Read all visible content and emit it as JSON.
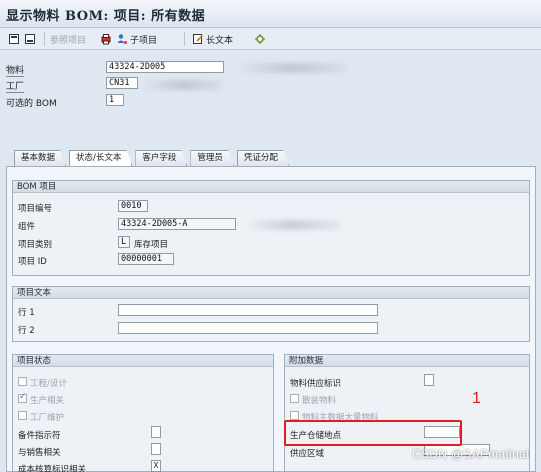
{
  "window": {
    "title": "显示物料 BOM: 项目: 所有数据"
  },
  "toolbar": {
    "ref_item_label": "参照项目",
    "sub_item_label": "子项目",
    "long_text_label": "长文本"
  },
  "header": {
    "material_label": "物料",
    "material_value": "43324-2D005",
    "plant_label": "工厂",
    "plant_value": "CN31",
    "alt_bom_label": "可选的 BOM",
    "alt_bom_value": "1"
  },
  "tabs": [
    {
      "label": "基本数据"
    },
    {
      "label": "状态/长文本"
    },
    {
      "label": "客户字段"
    },
    {
      "label": "管理员"
    },
    {
      "label": "凭证分配"
    }
  ],
  "bom_item": {
    "title": "BOM 项目",
    "item_no_label": "项目编号",
    "item_no_value": "0010",
    "component_label": "组件",
    "component_value": "43324-2D005-A",
    "item_cat_label": "项目类别",
    "item_cat_value": "L",
    "item_cat_text": "库存项目",
    "item_id_label": "项目 ID",
    "item_id_value": "00000001"
  },
  "item_text": {
    "title": "项目文本",
    "line1_label": "行 1",
    "line2_label": "行 2"
  },
  "item_status": {
    "title": "项目状态",
    "engineering_label": "工程/设计",
    "production_label": "生产相关",
    "plant_maint_label": "工厂维护",
    "spare_part_label": "备件指示符",
    "sales_label": "与销售相关",
    "costing_label": "成本核算标识相关",
    "costing_value": "X"
  },
  "additional_data": {
    "title": "附加数据",
    "vendor_ind_label": "物料供应标识",
    "bulk_label": "散装物料",
    "bulk_master_label": "物料主数据大量物料",
    "prod_storage_label": "生产仓储地点",
    "supply_area_label": "供应区域"
  },
  "annotation": {
    "marker": "1"
  },
  "watermark": "CSDN @SAPmatinal"
}
